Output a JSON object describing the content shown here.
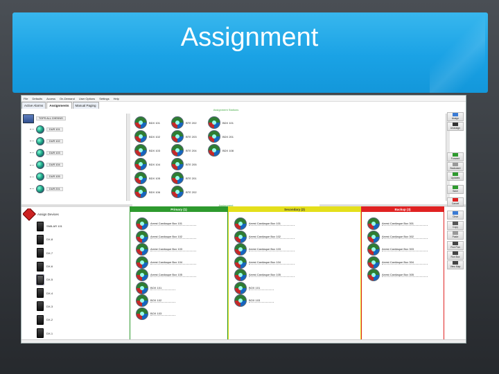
{
  "slide": {
    "title": "Assignment"
  },
  "app": {
    "menu": [
      "File",
      "Defaults",
      "Access",
      "On-Demand",
      "User Options",
      "Settings",
      "Help"
    ],
    "tabs": [
      "Active Alarms",
      "Assignments",
      "Manual Paging"
    ],
    "active_tab": "Assignments",
    "top_section_header": "Assignment Stations",
    "bottom_section_header": "Assignment",
    "tree": {
      "root": "TOPS ALL CHEKNS",
      "items": [
        "DUR 101",
        "DUR 102",
        "DUR 103",
        "DUR 104",
        "DUR 105",
        "DUR 201"
      ]
    },
    "units": [
      [
        "BDX 101",
        "BTE 202",
        "BDX 101"
      ],
      [
        "BDX 102",
        "BTE 203",
        "BDX 201"
      ],
      [
        "BDX 103",
        "BTE 204",
        "BDX 108"
      ],
      [
        "BDX 104",
        "BTE 205",
        ""
      ],
      [
        "BDX 105",
        "BTE 201",
        ""
      ],
      [
        "BDX 106",
        "BTE 202",
        ""
      ]
    ],
    "devices": {
      "header": "Assign Devices",
      "items": [
        "SNB-AR 101",
        "DX-8",
        "DX-7",
        "DX-6",
        "DX-5",
        "DX-4",
        "DX-3",
        "DX-2",
        "DX-1"
      ]
    },
    "columns": [
      {
        "name": "Primary (1)",
        "color": "#2e9a2e",
        "entries": [
          "Arrest Cardiaque Box 101",
          "Arrest Cardiaque Box 102",
          "Arrest Cardiaque Box 103",
          "Arrest Cardiaque Box 104",
          "Arrest Cardiaque Box 105",
          "BOX 101",
          "BOX 102",
          "BOX 103"
        ]
      },
      {
        "name": "Secondary (2)",
        "color": "#e4df1b",
        "entries": [
          "Arrest Cardiaque Box 101",
          "Arrest Cardiaque Box 102",
          "Arrest Cardiaque Box 103",
          "Arrest Cardiaque Box 104",
          "Arrest Cardiaque Box 105",
          "BOX 101",
          "BOX 103"
        ]
      },
      {
        "name": "Backup (3)",
        "color": "#e02222",
        "entries": [
          "Arrest Cardiaque Box 301",
          "Arrest Cardiaque Box 302",
          "Arrest Cardiaque Box 303",
          "Arrest Cardiaque Box 304",
          "Arrest Cardiaque Box 305"
        ]
      }
    ],
    "toolbar": [
      {
        "label": "Assign",
        "icon": "assign-icon",
        "color": "#3a7bd5"
      },
      {
        "label": "Unassign",
        "icon": "unassign-icon",
        "color": "#333"
      },
      {
        "label": "Forward",
        "icon": "forward-arrow-icon",
        "color": "#2e9a2e"
      },
      {
        "label": "Backward",
        "icon": "backward-arrow-icon",
        "color": "#999"
      },
      {
        "label": "Updates",
        "icon": "update-icon",
        "color": "#2e9a2e"
      },
      {
        "label": "Save",
        "icon": "check-icon",
        "color": "#2e9a2e"
      },
      {
        "label": "Cancel",
        "icon": "cancel-icon",
        "color": "#d22"
      },
      {
        "label": "Clear",
        "icon": "clear-icon",
        "color": "#3a7bd5"
      },
      {
        "label": "Copy",
        "icon": "copy-icon",
        "color": "#555"
      },
      {
        "label": "Paste",
        "icon": "paste-icon",
        "color": "#999"
      },
      {
        "label": "Run Pan",
        "icon": "run-pan-icon",
        "color": "#444"
      },
      {
        "label": "Run Box",
        "icon": "run-box-icon",
        "color": "#444"
      },
      {
        "label": "View Map",
        "icon": "map-icon",
        "color": "#444"
      }
    ]
  }
}
